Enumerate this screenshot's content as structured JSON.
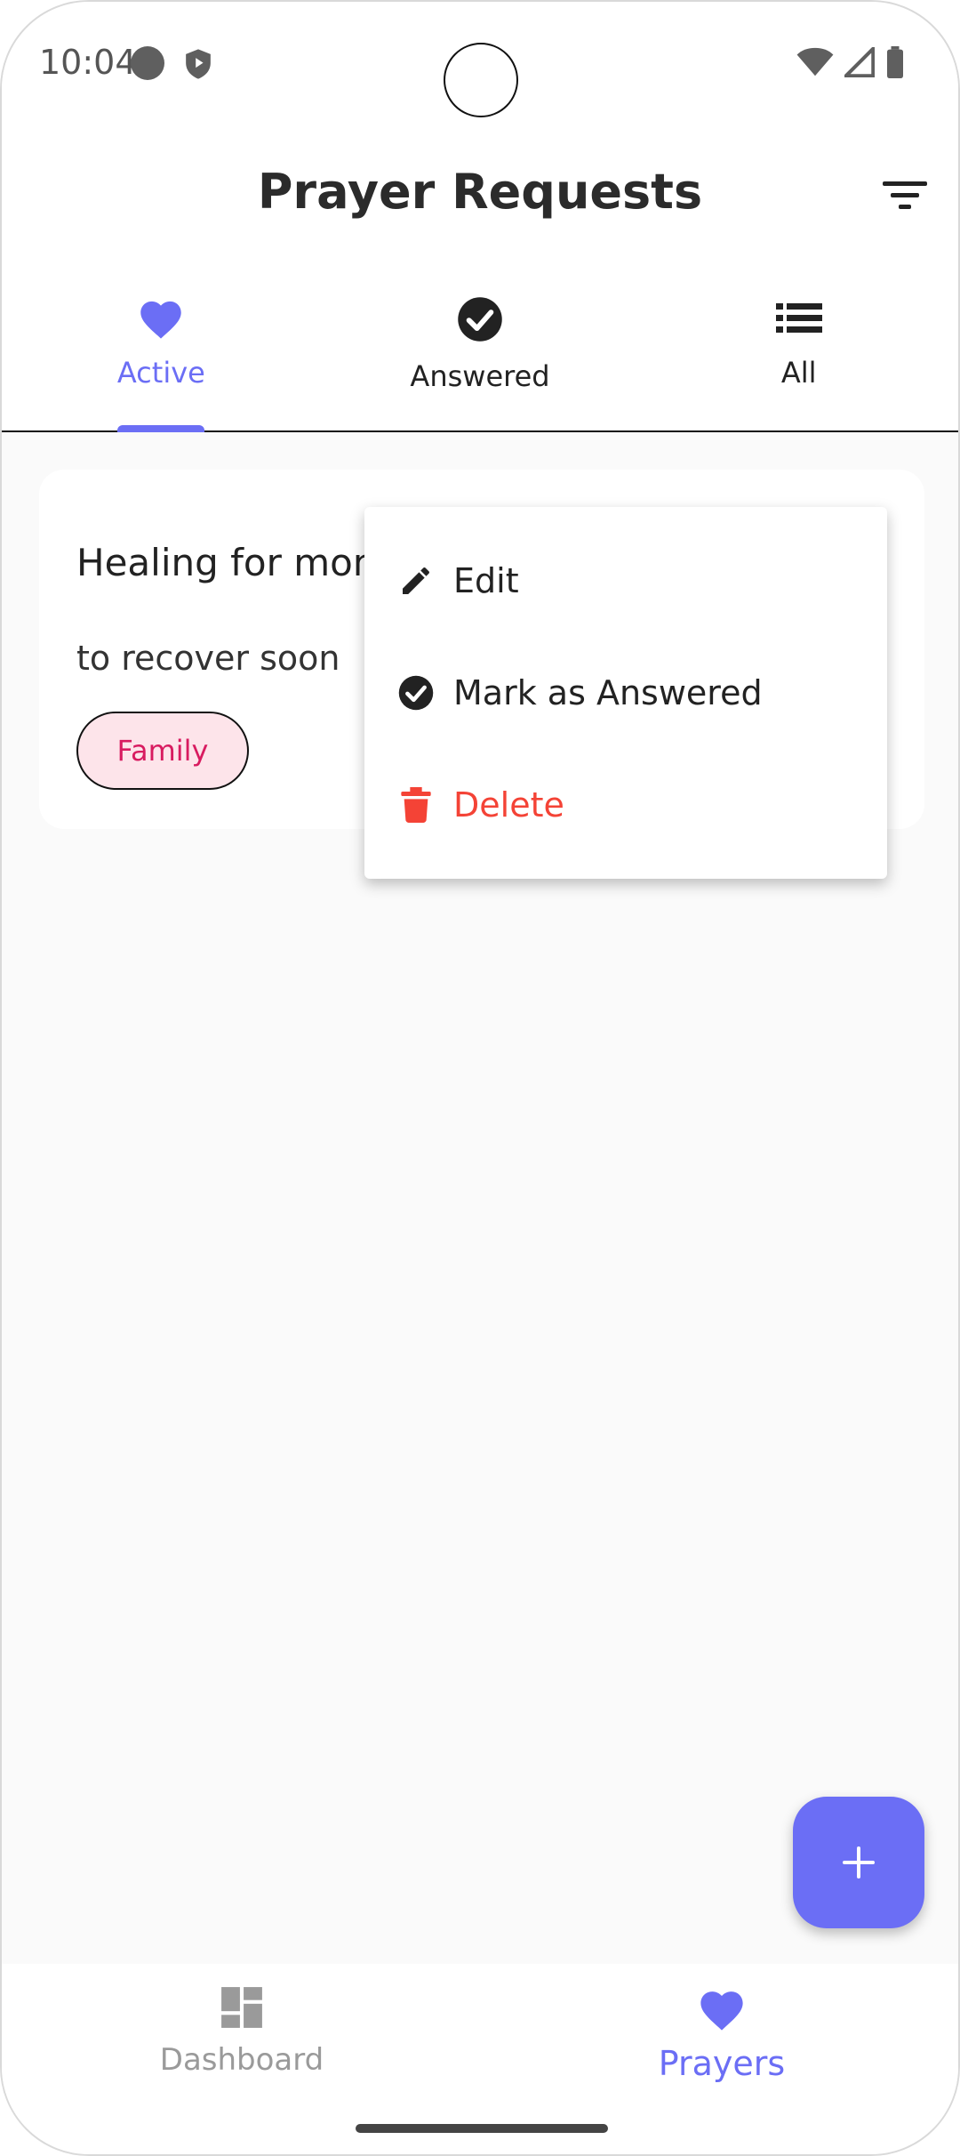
{
  "status_bar": {
    "time": "10:04",
    "icons": [
      "circle-icon",
      "shield-icon",
      "wifi-icon",
      "signal-icon",
      "battery-icon"
    ]
  },
  "app_bar": {
    "title": "Prayer Requests",
    "filter_icon": "filter-icon"
  },
  "tabs": [
    {
      "label": "Active",
      "icon": "heart-icon",
      "selected": true
    },
    {
      "label": "Answered",
      "icon": "check-circle-icon",
      "selected": false
    },
    {
      "label": "All",
      "icon": "list-icon",
      "selected": false
    }
  ],
  "card": {
    "title": "Healing for mom",
    "description": "to recover soon",
    "chip": "Family"
  },
  "menu": {
    "items": [
      {
        "label": "Edit",
        "icon": "pencil-icon"
      },
      {
        "label": "Mark as Answered",
        "icon": "check-circle-icon"
      },
      {
        "label": "Delete",
        "icon": "trash-icon"
      }
    ]
  },
  "fab": {
    "icon": "plus-icon"
  },
  "bottom_nav": {
    "items": [
      {
        "label": "Dashboard",
        "icon": "dashboard-icon",
        "selected": false
      },
      {
        "label": "Prayers",
        "icon": "heart-icon",
        "selected": true
      }
    ]
  },
  "colors": {
    "accent": "#6b6ef5",
    "danger": "#f44336",
    "chip_text": "#d81b60",
    "chip_bg": "#fde4ea",
    "background": "#fafafa"
  }
}
